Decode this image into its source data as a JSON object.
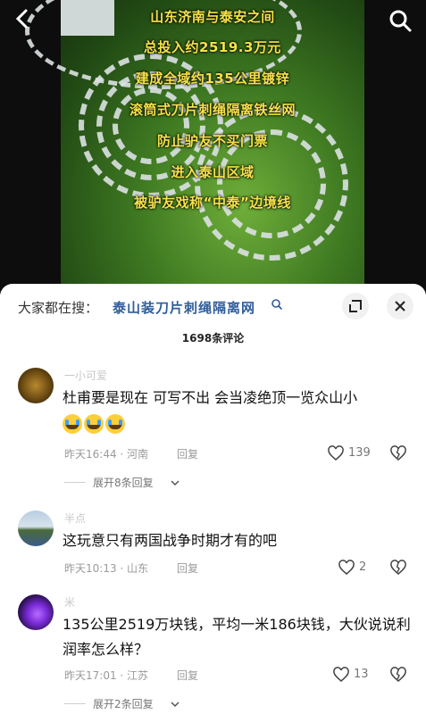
{
  "video": {
    "captions": [
      "山东济南与泰安之间",
      "总投入约2519.3万元",
      "建成全域约135公里镀锌",
      "滚筒式刀片刺绳隔离铁丝网",
      "防止驴友不买门票",
      "进入泰山区域",
      "被驴友戏称“中泰”边境线"
    ]
  },
  "search": {
    "prefix": "大家都在搜：",
    "query": "泰山装刀片刺绳隔离网"
  },
  "comments_header": {
    "count_label": "1698条评论"
  },
  "comments": [
    {
      "username": "一小可爱",
      "text": "杜甫要是现在 可写不出 会当凌绝顶一览众山小",
      "meta": "昨天16:44 · 河南",
      "reply_label": "回复",
      "likes": "139",
      "expand_label": "展开8条回复"
    },
    {
      "username": "半点",
      "text": "这玩意只有两国战争时期才有的吧",
      "meta": "昨天10:13 · 山东",
      "reply_label": "回复",
      "likes": "2"
    },
    {
      "username": "米",
      "text": "135公里2519万块钱，平均一米186块钱，大伙说说利润率怎么样？",
      "meta": "昨天17:01 · 江苏",
      "reply_label": "回复",
      "likes": "13",
      "expand_label": "展开2条回复"
    }
  ],
  "colors": {
    "caption": "#f6e24a",
    "search_link": "#2f5d9b",
    "meta": "#9a9a9a"
  },
  "icons": [
    "back-icon",
    "search-icon",
    "expand-icon",
    "close-icon",
    "heart-icon",
    "broken-heart-icon",
    "chevron-down-icon"
  ]
}
